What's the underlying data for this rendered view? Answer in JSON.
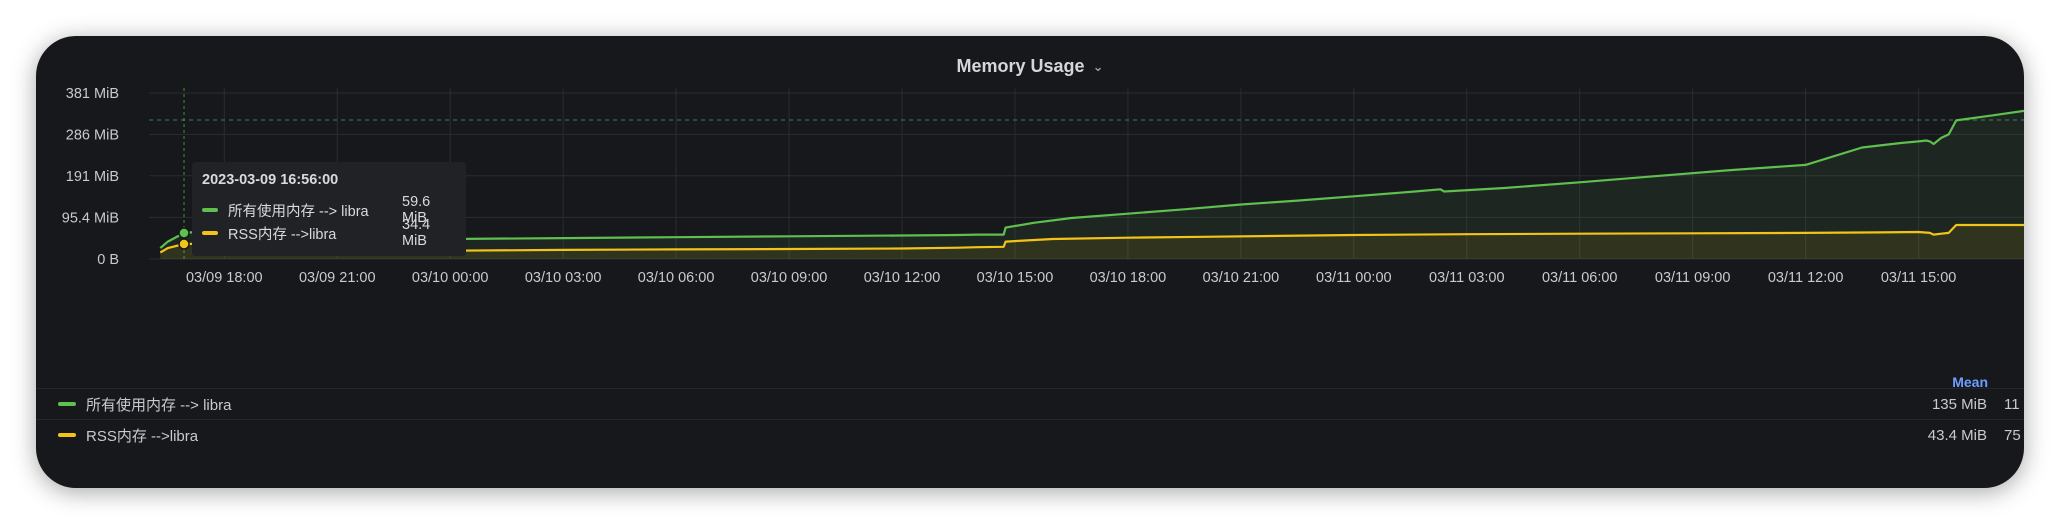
{
  "panel": {
    "title": "Memory Usage",
    "menu_icon": "chevron-down-icon"
  },
  "colors": {
    "background": "#17181c",
    "grid": "#2a2c31",
    "green": "#5fbf4f",
    "yellow": "#f2c318",
    "mean_header": "#6e9fff"
  },
  "tooltip": {
    "time": "2023-03-09 16:56:00",
    "rows": [
      {
        "name": "所有使用内存 --> libra",
        "value": "59.6 MiB"
      },
      {
        "name": "RSS内存 -->libra",
        "value": "34.4 MiB"
      }
    ]
  },
  "legend": {
    "mean_header": "Mean",
    "rows": [
      {
        "name": "所有使用内存 --> libra",
        "mean": "135 MiB",
        "max_partial": "11"
      },
      {
        "name": "RSS内存 -->libra",
        "mean": "43.4 MiB",
        "max_partial": "75"
      }
    ]
  },
  "chart_data": {
    "type": "area",
    "title": "Memory Usage",
    "xlabel": "",
    "ylabel": "",
    "y_unit": "MiB",
    "ylim": [
      0,
      381
    ],
    "y_ticks": [
      0,
      95.4,
      191,
      286,
      381
    ],
    "y_tick_labels": [
      "0 B",
      "95.4 MiB",
      "191 MiB",
      "286 MiB",
      "381 MiB"
    ],
    "x_range": [
      "03/09 16:00",
      "03/11 16:45"
    ],
    "x_tick_labels": [
      "03/09 18:00",
      "03/09 21:00",
      "03/10 00:00",
      "03/10 03:00",
      "03/10 06:00",
      "03/10 09:00",
      "03/10 12:00",
      "03/10 15:00",
      "03/10 18:00",
      "03/10 21:00",
      "03/11 00:00",
      "03/11 03:00",
      "03/11 06:00",
      "03/11 09:00",
      "03/11 12:00",
      "03/11 15:00"
    ],
    "x_tick_hours": [
      18,
      21,
      24,
      27,
      30,
      33,
      36,
      39,
      42,
      45,
      48,
      51,
      54,
      57,
      60,
      63
    ],
    "grid": true,
    "hover": {
      "x": "03/09 16:56",
      "x_hours": 16.93,
      "threshold_y": 319
    },
    "series": [
      {
        "name": "所有使用内存 --> libra",
        "color": "#5fbf4f",
        "points": [
          [
            16.3,
            25
          ],
          [
            16.5,
            40
          ],
          [
            16.93,
            59.6
          ],
          [
            17.5,
            64
          ],
          [
            18.5,
            68
          ],
          [
            19.5,
            74
          ],
          [
            20.5,
            82
          ],
          [
            20.9,
            86
          ],
          [
            20.92,
            38
          ],
          [
            21.3,
            43
          ],
          [
            24,
            46
          ],
          [
            27,
            48
          ],
          [
            30,
            50
          ],
          [
            33,
            52
          ],
          [
            36,
            54
          ],
          [
            37.5,
            55
          ],
          [
            38,
            56
          ],
          [
            38.7,
            56
          ],
          [
            38.75,
            72
          ],
          [
            39.5,
            83
          ],
          [
            40.5,
            94
          ],
          [
            42,
            104
          ],
          [
            43.5,
            114
          ],
          [
            45,
            125
          ],
          [
            46.5,
            134
          ],
          [
            48,
            144
          ],
          [
            49.5,
            154
          ],
          [
            50.3,
            160
          ],
          [
            50.4,
            155
          ],
          [
            52,
            163
          ],
          [
            54,
            176
          ],
          [
            56,
            190
          ],
          [
            58,
            204
          ],
          [
            60,
            216
          ],
          [
            61.5,
            256
          ],
          [
            62.5,
            266
          ],
          [
            63,
            270
          ],
          [
            63.2,
            272
          ],
          [
            63.3,
            270
          ],
          [
            63.4,
            264
          ],
          [
            63.6,
            278
          ],
          [
            63.8,
            286
          ],
          [
            64,
            318
          ],
          [
            65,
            330
          ],
          [
            65.8,
            340
          ]
        ]
      },
      {
        "name": "RSS内存 -->libra",
        "color": "#f2c318",
        "points": [
          [
            16.3,
            15
          ],
          [
            16.5,
            25
          ],
          [
            16.93,
            34.4
          ],
          [
            18,
            36
          ],
          [
            19.5,
            38
          ],
          [
            20.5,
            40
          ],
          [
            20.9,
            41
          ],
          [
            20.92,
            12
          ],
          [
            21.3,
            18
          ],
          [
            24,
            19
          ],
          [
            27,
            21
          ],
          [
            30,
            22
          ],
          [
            33,
            23
          ],
          [
            36,
            24
          ],
          [
            37.5,
            26
          ],
          [
            38,
            27
          ],
          [
            38.7,
            28
          ],
          [
            38.75,
            40
          ],
          [
            40,
            46
          ],
          [
            42,
            49
          ],
          [
            44,
            51
          ],
          [
            46,
            53
          ],
          [
            48,
            55
          ],
          [
            51,
            57
          ],
          [
            54,
            58
          ],
          [
            57,
            59
          ],
          [
            60,
            60
          ],
          [
            62,
            61
          ],
          [
            63,
            62
          ],
          [
            63.3,
            60
          ],
          [
            63.4,
            56
          ],
          [
            63.6,
            58
          ],
          [
            63.8,
            60
          ],
          [
            64,
            78
          ],
          [
            65,
            78
          ],
          [
            65.8,
            78
          ]
        ]
      }
    ]
  }
}
